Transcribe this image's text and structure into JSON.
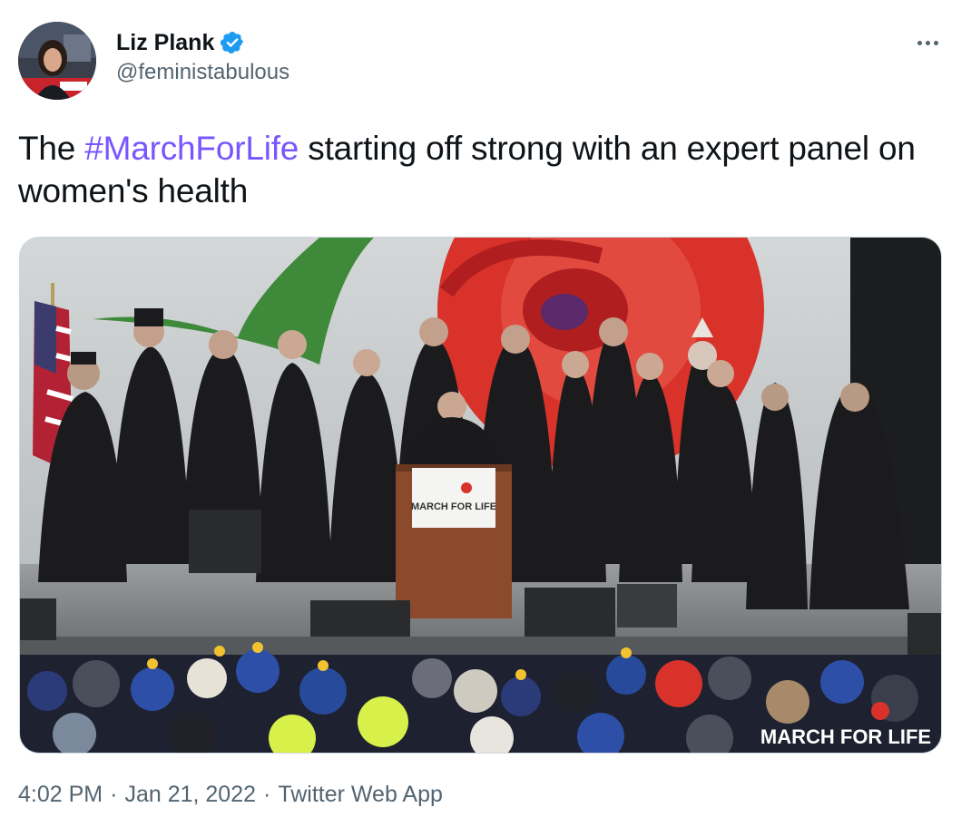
{
  "author": {
    "display_name": "Liz Plank",
    "handle": "@feministabulous",
    "verified": true,
    "verified_icon": "verified-badge-icon"
  },
  "tweet": {
    "text_before": "The ",
    "hashtag": "#MarchForLife",
    "text_after": " starting off strong with an expert panel on women's health"
  },
  "media": {
    "podium_sign": "MARCH FOR LIFE",
    "watermark": "MARCH FOR LIFE"
  },
  "meta": {
    "time": "4:02 PM",
    "separator": "·",
    "date": "Jan 21, 2022",
    "source": "Twitter Web App"
  },
  "colors": {
    "hashtag": "#7856ff",
    "verified": "#1d9bf0",
    "secondary_text": "#536471"
  }
}
